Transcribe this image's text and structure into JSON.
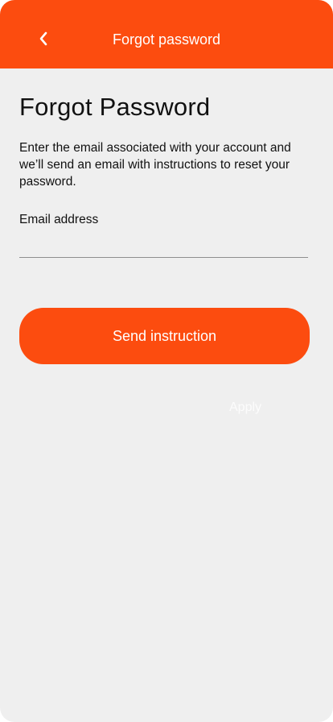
{
  "header": {
    "title": "Forgot password",
    "background_color": "#fc4c0f",
    "back_icon": "chevron-left-icon"
  },
  "main": {
    "title": "Forgot Password",
    "description": "Enter the email associated with your account and we’ll send an email with instructions to reset your password.",
    "email_label": "Email address",
    "email_value": "",
    "email_placeholder": "",
    "send_button_label": "Send instruction",
    "ghost_label": "Apply"
  },
  "colors": {
    "accent": "#fc4c0f",
    "page_background": "#efefef",
    "text": "#111111"
  }
}
